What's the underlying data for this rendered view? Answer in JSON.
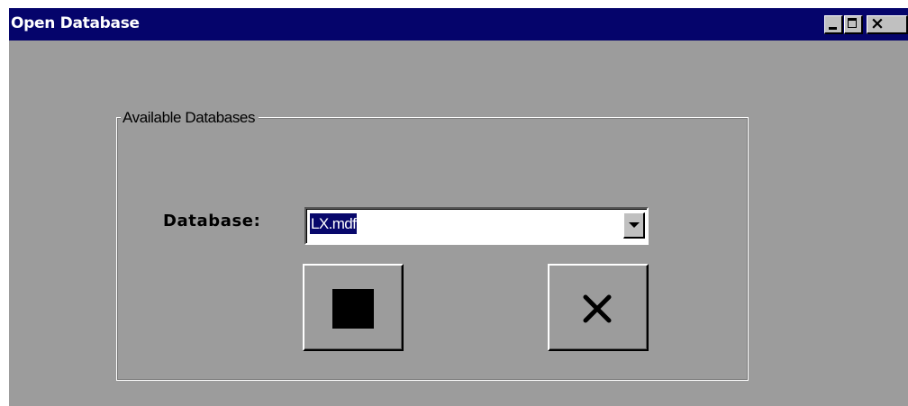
{
  "window": {
    "title": "Open Database",
    "titlebar_color": "#05046b",
    "body_color": "#9c9c9c",
    "controls": [
      "minimize-icon",
      "maximize-icon",
      "close-icon"
    ],
    "close_glyph": "×"
  },
  "group": {
    "legend": "Available Databases"
  },
  "database": {
    "label": "Database:",
    "selected_value": "LX.mdf"
  },
  "buttons": {
    "ok_icon": "square-stop-icon",
    "cancel_icon": "x-cancel-icon"
  }
}
